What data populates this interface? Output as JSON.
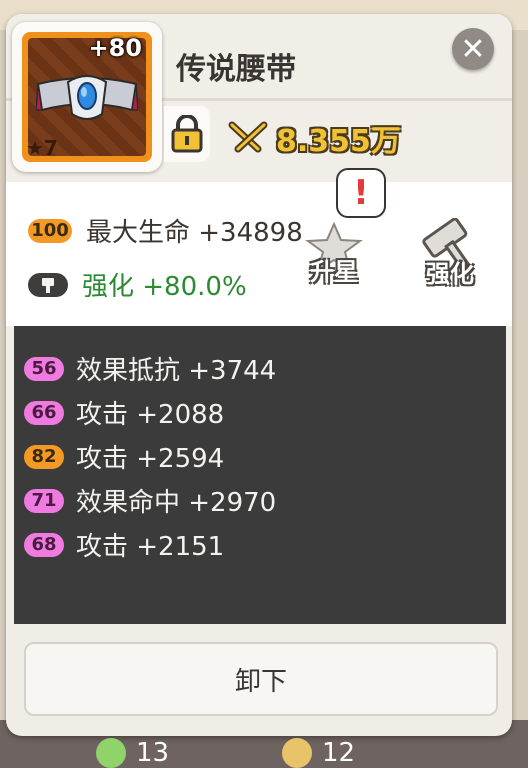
{
  "item": {
    "name": "传说腰带",
    "level_bonus": "+80",
    "stars": "★7",
    "power": "8.355万"
  },
  "main_stats": [
    {
      "badge": "100",
      "text": "最大生命 +34898"
    },
    {
      "badge_icon": "hammer-icon",
      "text": "强化 +80.0%"
    }
  ],
  "actions": {
    "star_up_label": "升星",
    "enhance_label": "强化",
    "alert_symbol": "!"
  },
  "sub_stats": [
    {
      "badge": "56",
      "text": "效果抵抗 +3744",
      "color": "#f07be0"
    },
    {
      "badge": "66",
      "text": "攻击 +2088",
      "color": "#f07be0"
    },
    {
      "badge": "82",
      "text": "攻击 +2594",
      "color": "#f39a26"
    },
    {
      "badge": "71",
      "text": "效果命中 +2970",
      "color": "#f07be0"
    },
    {
      "badge": "68",
      "text": "攻击 +2151",
      "color": "#f07be0"
    }
  ],
  "buttons": {
    "unequip_label": "卸下",
    "close_symbol": "✕"
  },
  "resources": [
    {
      "icon": "green-gem-icon",
      "value": "13"
    },
    {
      "icon": "gold-coin-icon",
      "value": "12"
    }
  ]
}
